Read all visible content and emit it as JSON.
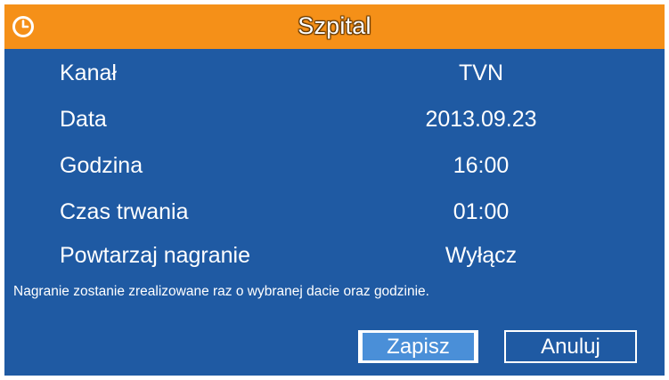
{
  "header": {
    "title": "Szpital",
    "icon": "clock-icon"
  },
  "details": [
    {
      "label": "Kanał",
      "value": "TVN"
    },
    {
      "label": "Data",
      "value": "2013.09.23"
    },
    {
      "label": "Godzina",
      "value": "16:00"
    },
    {
      "label": "Czas trwania",
      "value": "01:00"
    },
    {
      "label": "Powtarzaj nagranie",
      "value": "Wyłącz"
    }
  ],
  "note": "Nagranie zostanie zrealizowane raz o wybranej dacie oraz godzinie.",
  "buttons": {
    "save_label": "Zapisz",
    "cancel_label": "Anuluj"
  },
  "colors": {
    "background": "#1f5aa3",
    "title_bar": "#f59018",
    "selected_button": "#4a8fd8",
    "text": "#ffffff"
  }
}
